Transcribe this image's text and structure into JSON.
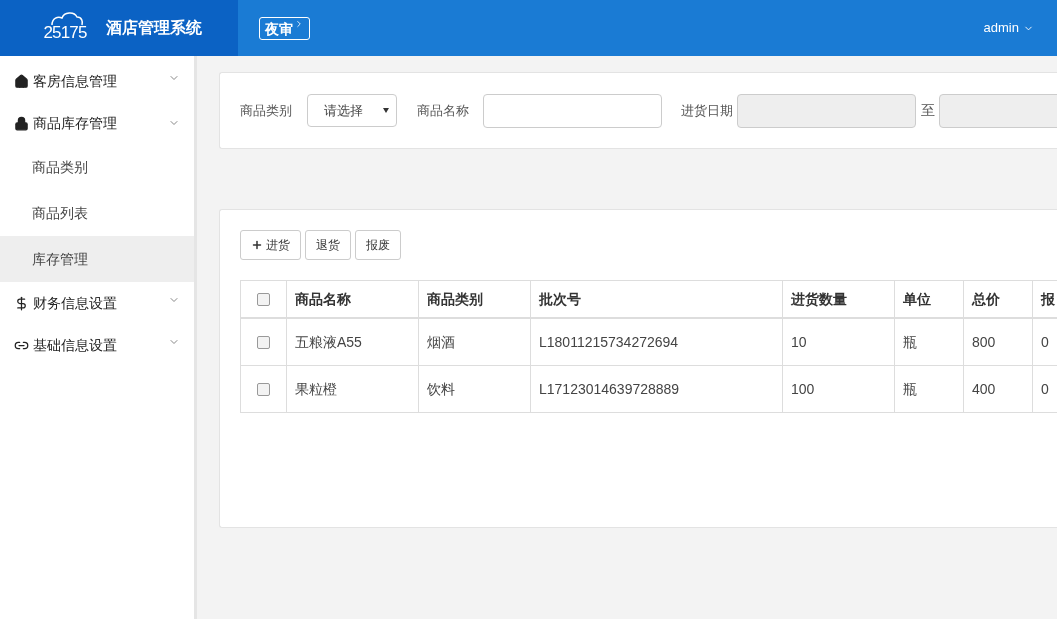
{
  "header": {
    "logo": "25175",
    "title": "酒店管理系统",
    "night_audit": "夜审",
    "user": "admin"
  },
  "sidebar": {
    "items": [
      {
        "label": "客房信息管理",
        "expanded": false
      },
      {
        "label": "商品库存管理",
        "expanded": true,
        "children": [
          {
            "label": "商品类别",
            "selected": false
          },
          {
            "label": "商品列表",
            "selected": false
          },
          {
            "label": "库存管理",
            "selected": true
          }
        ]
      },
      {
        "label": "财务信息设置",
        "expanded": false
      },
      {
        "label": "基础信息设置",
        "expanded": false
      }
    ]
  },
  "filters": {
    "category_label": "商品类别",
    "category_value": "请选择",
    "name_label": "商品名称",
    "date_label": "进货日期",
    "date_to": "至"
  },
  "toolbar": [
    "进货",
    "退货",
    "报废"
  ],
  "table": {
    "select_all_checked": false,
    "columns": [
      "商品名称",
      "商品类别",
      "批次号",
      "进货数量",
      "单位",
      "总价",
      "报"
    ],
    "rows": [
      {
        "checked": false,
        "cells": [
          "五粮液A55",
          "烟酒",
          "L18011215734272694",
          "10",
          "瓶",
          "800",
          "0"
        ]
      },
      {
        "checked": false,
        "cells": [
          "果粒橙",
          "饮料",
          "L17123014639728889",
          "100",
          "瓶",
          "400",
          "0"
        ]
      }
    ]
  }
}
